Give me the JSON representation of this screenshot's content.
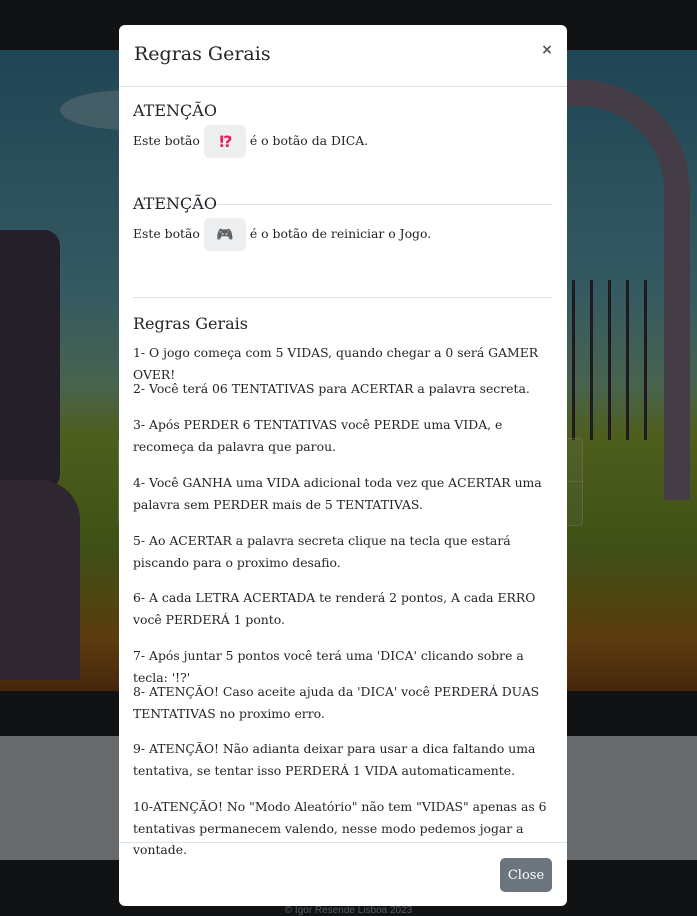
{
  "modal": {
    "title": "Regras Gerais",
    "close_symbol": "×",
    "notice1": {
      "heading": "ATENÇÃO",
      "before": "Este botão",
      "icon_glyph": "⁉",
      "icon_name": "hint-icon",
      "after": "é o botão da DICA."
    },
    "notice2": {
      "heading": "ATENÇÃO",
      "before": "Este botão",
      "icon_glyph": "🎮",
      "icon_name": "gamepad-icon",
      "after": "é o botão de reiniciar o Jogo."
    },
    "rules_heading": "Regras Gerais",
    "rules": [
      "1- O jogo começa com 5 VIDAS, quando chegar a 0 será GAMER OVER!",
      "2- Você terá 06 TENTATIVAS para ACERTAR a palavra secreta.",
      "3- Após PERDER 6 TENTATIVAS você PERDE uma VIDA, e recomeça da palavra que parou.",
      "4- Você GANHA uma VIDA adicional toda vez que ACERTAR uma palavra sem PERDER mais de 5 TENTATIVAS.",
      "5- Ao ACERTAR a palavra secreta clique na tecla que estará piscando para o proximo desafio.",
      "6- A cada LETRA ACERTADA te renderá 2 pontos, A cada ERRO você PERDERÁ 1 ponto.",
      "7- Após juntar 5 pontos você terá uma 'DICA' clicando sobre a tecla: '!?'",
      "8- ATENÇÃO! Caso aceite ajuda da 'DICA' você PERDERÁ DUAS TENTATIVAS no proximo erro.",
      "9- ATENÇÃO! Não adianta deixar para usar a dica faltando uma tentativa, se tentar isso PERDERÁ 1 VIDA automaticamente.",
      "10-ATENÇÃO! No \"Modo Aleatório\" não tem \"VIDAS\" apenas as 6 tentativas permanecem valendo, nesse modo pedemos jogar a vontade."
    ],
    "close_button": "Close"
  },
  "footer": {
    "copyright": "© Igor Resende Lisboa 2023"
  }
}
